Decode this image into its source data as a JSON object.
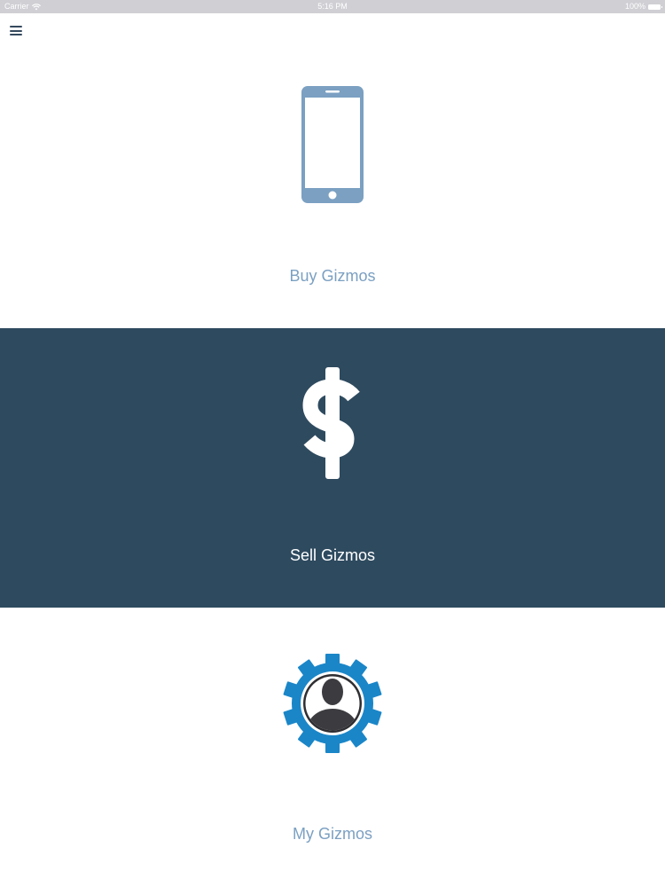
{
  "status_bar": {
    "carrier": "Carrier",
    "time": "5:16 PM",
    "battery": "100%"
  },
  "header": {
    "menu_icon": "hamburger-menu-icon"
  },
  "panels": [
    {
      "label": "Buy Gizmos",
      "icon": "phone-icon",
      "background": "#ffffff",
      "text_color": "#7ba0c2"
    },
    {
      "label": "Sell Gizmos",
      "icon": "dollar-icon",
      "background": "#2e4a5f",
      "text_color": "#ffffff"
    },
    {
      "label": "My Gizmos",
      "icon": "user-gear-icon",
      "background": "#ffffff",
      "text_color": "#7ba0c2"
    }
  ],
  "colors": {
    "accent_blue": "#7ba0c2",
    "dark_panel": "#2e4a5f",
    "gear_blue": "#1a86c8",
    "status_bar": "#cfcfd4"
  }
}
